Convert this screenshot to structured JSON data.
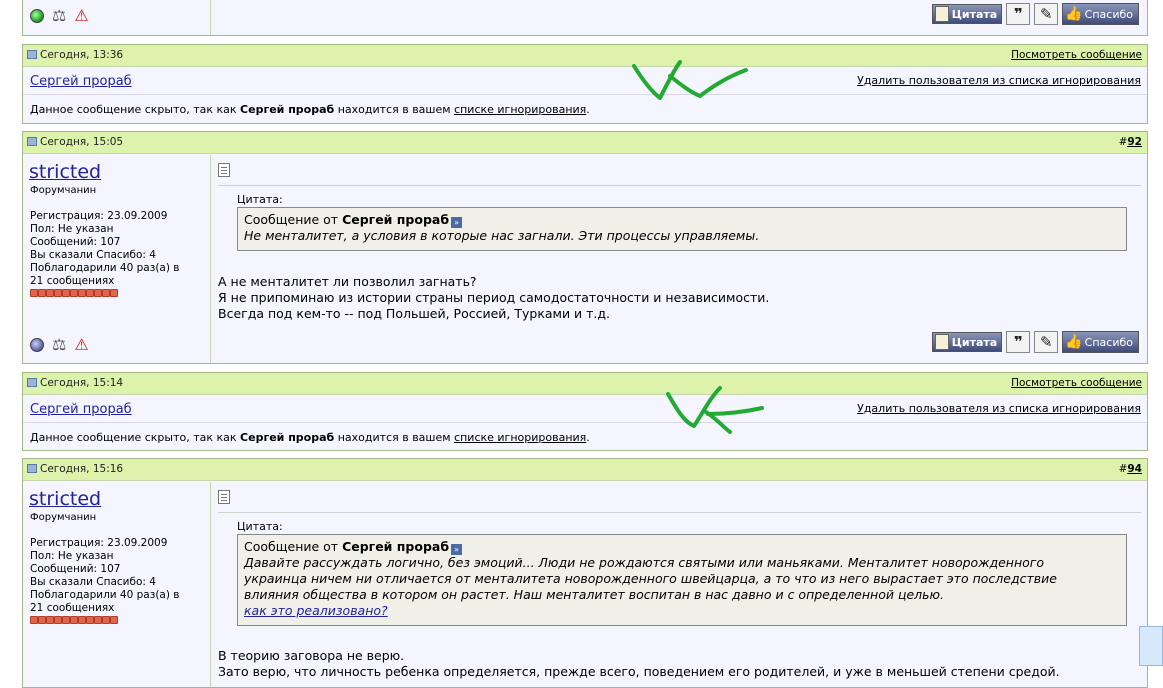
{
  "top_fragment": {
    "buttons": {
      "quote": "Цитата",
      "thanks": "Спасибо"
    }
  },
  "posts": [
    {
      "type": "ignored",
      "date": "Сегодня, 13:36",
      "view_link": "Посмотреть сообщение",
      "username": "Сергей прораб",
      "remove_link": "Удалить пользователя из списка игнорирования",
      "hidden_prefix": "Данное сообщение скрыто, так как",
      "hidden_user": "Сергей прораб",
      "hidden_mid": "находится в вашем",
      "hidden_link": "списке игнорирования",
      "hidden_end": "."
    },
    {
      "type": "post",
      "date": "Сегодня, 15:05",
      "number_prefix": "#",
      "number": "92",
      "username": "stricted",
      "user_title": "Форумчанин",
      "info": [
        "Регистрация: 23.09.2009",
        "Пол: Не указан",
        "Сообщений: 107",
        "Вы сказали Спасибо: 4",
        "Поблагодарили 40 раз(а) в",
        "21 сообщениях"
      ],
      "quote_label": "Цитата:",
      "quote_from": "Сообщение от",
      "quote_author": "Сергей прораб",
      "quote_lines": [
        "Не менталитет, а условия в которые нас загнали. Эти процессы управляемы."
      ],
      "body": [
        "А не менталитет ли позволил загнать?",
        "Я не припоминаю из истории страны период самодостаточности и независимости.",
        "Всегда под кем-то -- под Польшей, Россией, Турками и т.д."
      ],
      "buttons": {
        "quote": "Цитата",
        "thanks": "Спасибо"
      }
    },
    {
      "type": "ignored",
      "date": "Сегодня, 15:14",
      "view_link": "Посмотреть сообщение",
      "username": "Сергей прораб",
      "remove_link": "Удалить пользователя из списка игнорирования",
      "hidden_prefix": "Данное сообщение скрыто, так как",
      "hidden_user": "Сергей прораб",
      "hidden_mid": "находится в вашем",
      "hidden_link": "списке игнорирования",
      "hidden_end": "."
    },
    {
      "type": "post",
      "date": "Сегодня, 15:16",
      "number_prefix": "#",
      "number": "94",
      "username": "stricted",
      "user_title": "Форумчанин",
      "info": [
        "Регистрация: 23.09.2009",
        "Пол: Не указан",
        "Сообщений: 107",
        "Вы сказали Спасибо: 4",
        "Поблагодарили 40 раз(а) в",
        "21 сообщениях"
      ],
      "quote_label": "Цитата:",
      "quote_from": "Сообщение от",
      "quote_author": "Сергей прораб",
      "quote_lines": [
        "Давайте рассуждать логично, без эмоций... Люди не рождаются святыми или маньяками. Менталитет новорожденного",
        "украинца ничем ни отличается от менталитета новорожденного швейцарца, а то что из него вырастает это последствие",
        "влияния общества в котором он растет. Наш менталитет воспитан в нас давно и с определенной целью."
      ],
      "quote_link": "как это реализовано?",
      "body": [
        "В теорию заговора не верю.",
        "Зато верю, что личность ребенка определяется, прежде всего, поведением его родителей, и уже в меньшей степени средой."
      ]
    }
  ]
}
